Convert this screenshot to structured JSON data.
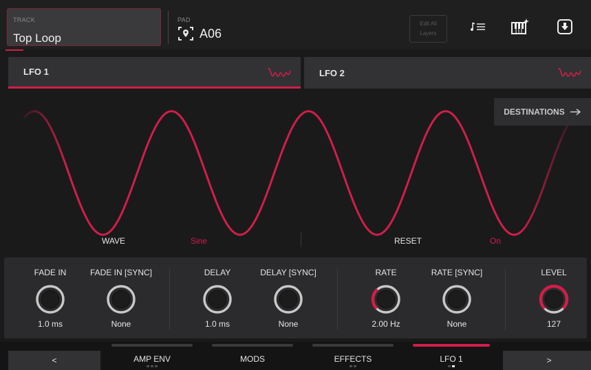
{
  "header": {
    "track_label": "TRACK",
    "track_name": "Top Loop",
    "pad_label": "PAD",
    "pad_value": "A06",
    "edit_all_layers": "Edit All Layers",
    "icons": [
      "note-list-icon",
      "keyboard-sparkle-icon",
      "download-icon"
    ]
  },
  "tabs": [
    {
      "label": "LFO 1",
      "active": true,
      "icon": "sine-wave-icon"
    },
    {
      "label": "LFO 2",
      "active": false,
      "icon": "sine-wave-icon"
    }
  ],
  "destinations": {
    "label": "DESTINATIONS",
    "icon": "arrow-right-icon"
  },
  "params": {
    "wave_label": "WAVE",
    "wave_value": "Sine",
    "reset_label": "RESET",
    "reset_value": "On"
  },
  "knobs": [
    {
      "label": "FADE IN",
      "value": "1.0 ms",
      "level": 0
    },
    {
      "label": "FADE IN [SYNC]",
      "value": "None",
      "level": 0
    },
    {
      "label": "DELAY",
      "value": "1.0 ms",
      "level": 0
    },
    {
      "label": "DELAY [SYNC]",
      "value": "None",
      "level": 0
    },
    {
      "label": "RATE",
      "value": "2.00 Hz",
      "level": 0.35
    },
    {
      "label": "RATE [SYNC]",
      "value": "None",
      "level": 0
    },
    {
      "label": "LEVEL",
      "value": "127",
      "level": 1.0
    }
  ],
  "bottom_nav": {
    "prev": "<",
    "next": ">",
    "tabs": [
      {
        "label": "AMP ENV",
        "active": false,
        "pages": 3,
        "current_page": 0
      },
      {
        "label": "MODS",
        "active": false,
        "pages": 0,
        "current_page": 0
      },
      {
        "label": "EFFECTS",
        "active": false,
        "pages": 2,
        "current_page": 0
      },
      {
        "label": "LFO 1",
        "active": true,
        "pages": 2,
        "current_page": 1
      }
    ]
  },
  "colors": {
    "accent": "#d11e48",
    "background": "#1a1a1b",
    "panel": "#2b2b2d"
  }
}
